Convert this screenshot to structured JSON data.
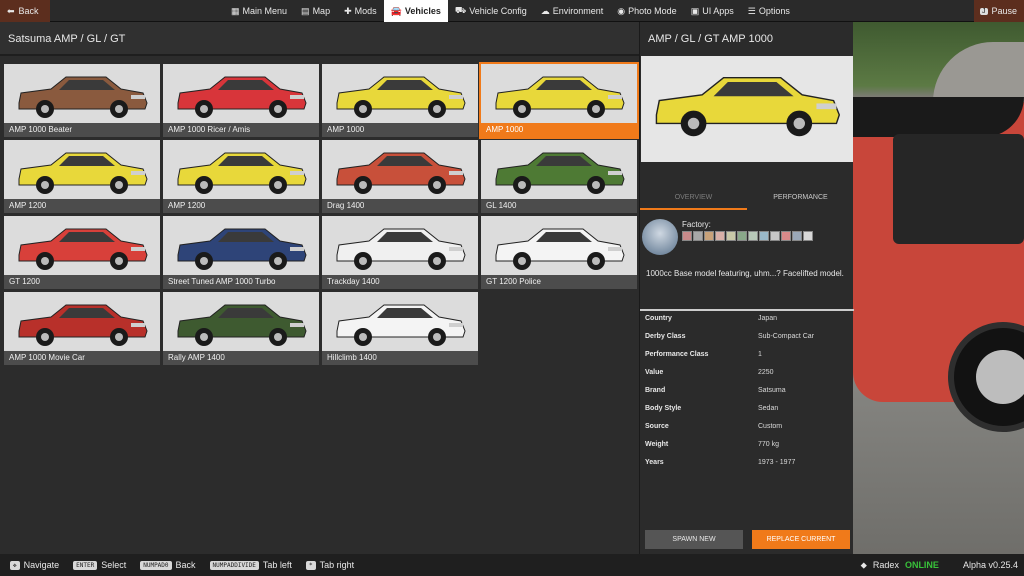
{
  "topbar": {
    "back_label": "Back",
    "pause_label": "Pause",
    "pause_key": "J",
    "nav": [
      {
        "icon": "▦",
        "label": "Main Menu"
      },
      {
        "icon": "▤",
        "label": "Map"
      },
      {
        "icon": "✚",
        "label": "Mods"
      },
      {
        "icon": "🚘",
        "label": "Vehicles",
        "active": true
      },
      {
        "icon": "⛟",
        "label": "Vehicle Config"
      },
      {
        "icon": "☁",
        "label": "Environment"
      },
      {
        "icon": "◉",
        "label": "Photo Mode"
      },
      {
        "icon": "▣",
        "label": "UI Apps"
      },
      {
        "icon": "☰",
        "label": "Options"
      }
    ]
  },
  "grid": {
    "title": "Satsuma AMP / GL / GT",
    "tiles": [
      {
        "label": "AMP 1000 Beater",
        "color": "#8a5a3e"
      },
      {
        "label": "AMP 1000 Ricer / Amis",
        "color": "#d8353a"
      },
      {
        "label": "AMP 1000",
        "color": "#e8d83a"
      },
      {
        "label": "AMP 1000",
        "color": "#e8d83a",
        "selected": true
      },
      {
        "label": "AMP 1200",
        "color": "#e8d83a"
      },
      {
        "label": "AMP 1200",
        "color": "#e8d83a"
      },
      {
        "label": "Drag 1400",
        "color": "#c8503a"
      },
      {
        "label": "GL 1400",
        "color": "#4e7a34"
      },
      {
        "label": "GT 1200",
        "color": "#d8403a"
      },
      {
        "label": "Street Tuned AMP 1000 Turbo",
        "color": "#2e4478"
      },
      {
        "label": "Trackday 1400",
        "color": "#f0f0f0"
      },
      {
        "label": "GT 1200 Police",
        "color": "#f4f4f4"
      },
      {
        "label": "AMP 1000 Movie Car",
        "color": "#b8302a"
      },
      {
        "label": "Rally AMP 1400",
        "color": "#3e5a30"
      },
      {
        "label": "Hillclimb 1400",
        "color": "#f4f4f4"
      }
    ]
  },
  "details": {
    "title": "AMP / GL / GT AMP 1000",
    "car_color": "#e8d83a",
    "tabs": [
      "OVERVIEW",
      "PERFORMANCE"
    ],
    "factory_label": "Factory:",
    "swatches": [
      "#c88a8a",
      "#a8a8a8",
      "#c8a27a",
      "#d8b0a8",
      "#c8c8a8",
      "#8aa88a",
      "#b8c8b8",
      "#9ab8c8",
      "#c8c8c8",
      "#d88a8a",
      "#9aa8b8",
      "#d8d8d8"
    ],
    "description": "1000cc Base model featuring, uhm...? Facelifted model.",
    "specs": [
      {
        "key": "Country",
        "value": "Japan"
      },
      {
        "key": "Derby Class",
        "value": "Sub-Compact Car"
      },
      {
        "key": "Performance Class",
        "value": "1"
      },
      {
        "key": "Value",
        "value": "2250"
      },
      {
        "key": "Brand",
        "value": "Satsuma"
      },
      {
        "key": "Body Style",
        "value": "Sedan"
      },
      {
        "key": "Source",
        "value": "Custom"
      },
      {
        "key": "Weight",
        "value": "770 kg"
      },
      {
        "key": "Years",
        "value": "1973 - 1977"
      }
    ],
    "spawn_label": "SPAWN NEW",
    "replace_label": "REPLACE CURRENT"
  },
  "bottombar": {
    "hints": [
      {
        "key": "✥",
        "label": "Navigate"
      },
      {
        "key": "ENTER",
        "label": "Select"
      },
      {
        "key": "NUMPAD0",
        "label": "Back"
      },
      {
        "key": "NUMPADDIVIDE",
        "label": "Tab left"
      },
      {
        "key": "*",
        "label": "Tab right"
      }
    ],
    "user": "Radex",
    "status": "ONLINE",
    "version": "Alpha v0.25.4"
  }
}
